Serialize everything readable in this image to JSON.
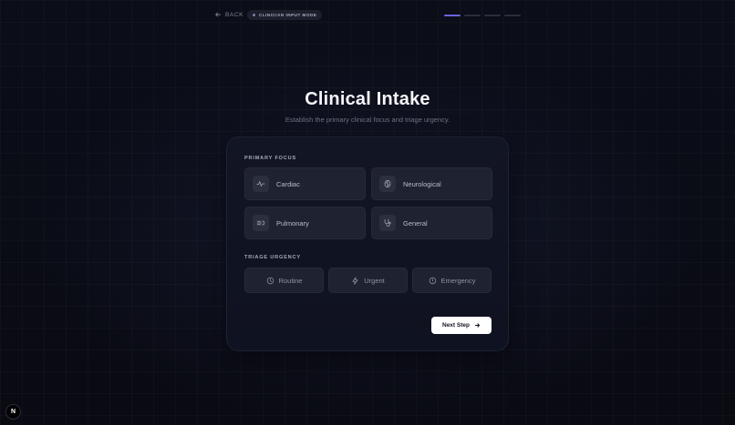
{
  "topbar": {
    "back_label": "BACK",
    "mode_badge": "CLINICIAN INPUT MODE",
    "progress": {
      "total_steps": 4,
      "current_step": 1
    }
  },
  "header": {
    "title": "Clinical Intake",
    "subtitle": "Establish the primary clinical focus and triage urgency."
  },
  "form": {
    "focus_label": "PRIMARY FOCUS",
    "focus_options": [
      {
        "label": "Cardiac",
        "icon": "heartbeat-icon"
      },
      {
        "label": "Neurological",
        "icon": "brain-icon"
      },
      {
        "label": "Pulmonary",
        "icon": "lungs-icon"
      },
      {
        "label": "General",
        "icon": "stethoscope-icon"
      }
    ],
    "urgency_label": "TRIAGE URGENCY",
    "urgency_options": [
      {
        "label": "Routine",
        "icon": "clock-icon"
      },
      {
        "label": "Urgent",
        "icon": "bolt-icon"
      },
      {
        "label": "Emergency",
        "icon": "alert-circle-icon"
      }
    ],
    "next_label": "Next Step"
  },
  "corner_badge": "N",
  "colors": {
    "background": "#0a0c16",
    "card": "#121524",
    "option": "#1f2230",
    "progress_active": "#6a66d6",
    "primary_button": "#ffffff"
  }
}
